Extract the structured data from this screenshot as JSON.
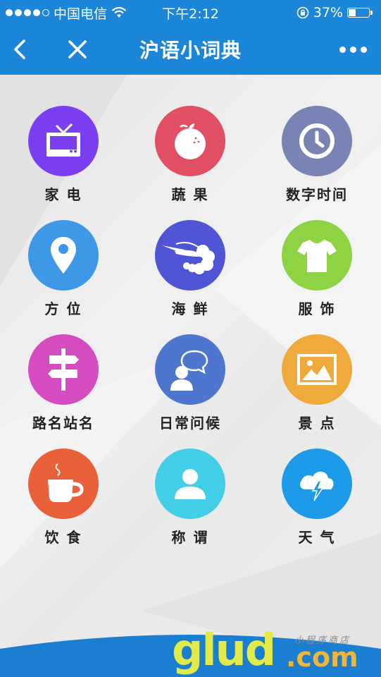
{
  "status": {
    "carrier": "中国电信",
    "time": "下午2:12",
    "battery": "37%",
    "battery_level": 0.37
  },
  "header": {
    "title": "沪语小词典"
  },
  "categories": [
    {
      "label": "家 电",
      "icon": "tv-icon",
      "color": "#7a3ff0"
    },
    {
      "label": "蔬 果",
      "icon": "orange-icon",
      "color": "#e04f63"
    },
    {
      "label": "数字时间",
      "icon": "clock-icon",
      "color": "#7a84b4"
    },
    {
      "label": "方 位",
      "icon": "location-pin-icon",
      "color": "#3f97e8"
    },
    {
      "label": "海 鲜",
      "icon": "seafood-icon",
      "color": "#4f55d4"
    },
    {
      "label": "服 饰",
      "icon": "tshirt-icon",
      "color": "#8ed343"
    },
    {
      "label": "路名站名",
      "icon": "signpost-icon",
      "color": "#d54bc0"
    },
    {
      "label": "日常问候",
      "icon": "chat-person-icon",
      "color": "#4f76ce"
    },
    {
      "label": "景 点",
      "icon": "picture-icon",
      "color": "#f0aa3c"
    },
    {
      "label": "饮 食",
      "icon": "cup-icon",
      "color": "#e8613b"
    },
    {
      "label": "称 谓",
      "icon": "person-icon",
      "color": "#43cfe8"
    },
    {
      "label": "天 气",
      "icon": "weather-icon",
      "color": "#1e9be8"
    }
  ],
  "watermark": {
    "main": "glud",
    "suffix": ".com",
    "tagline": "小程序商店"
  }
}
